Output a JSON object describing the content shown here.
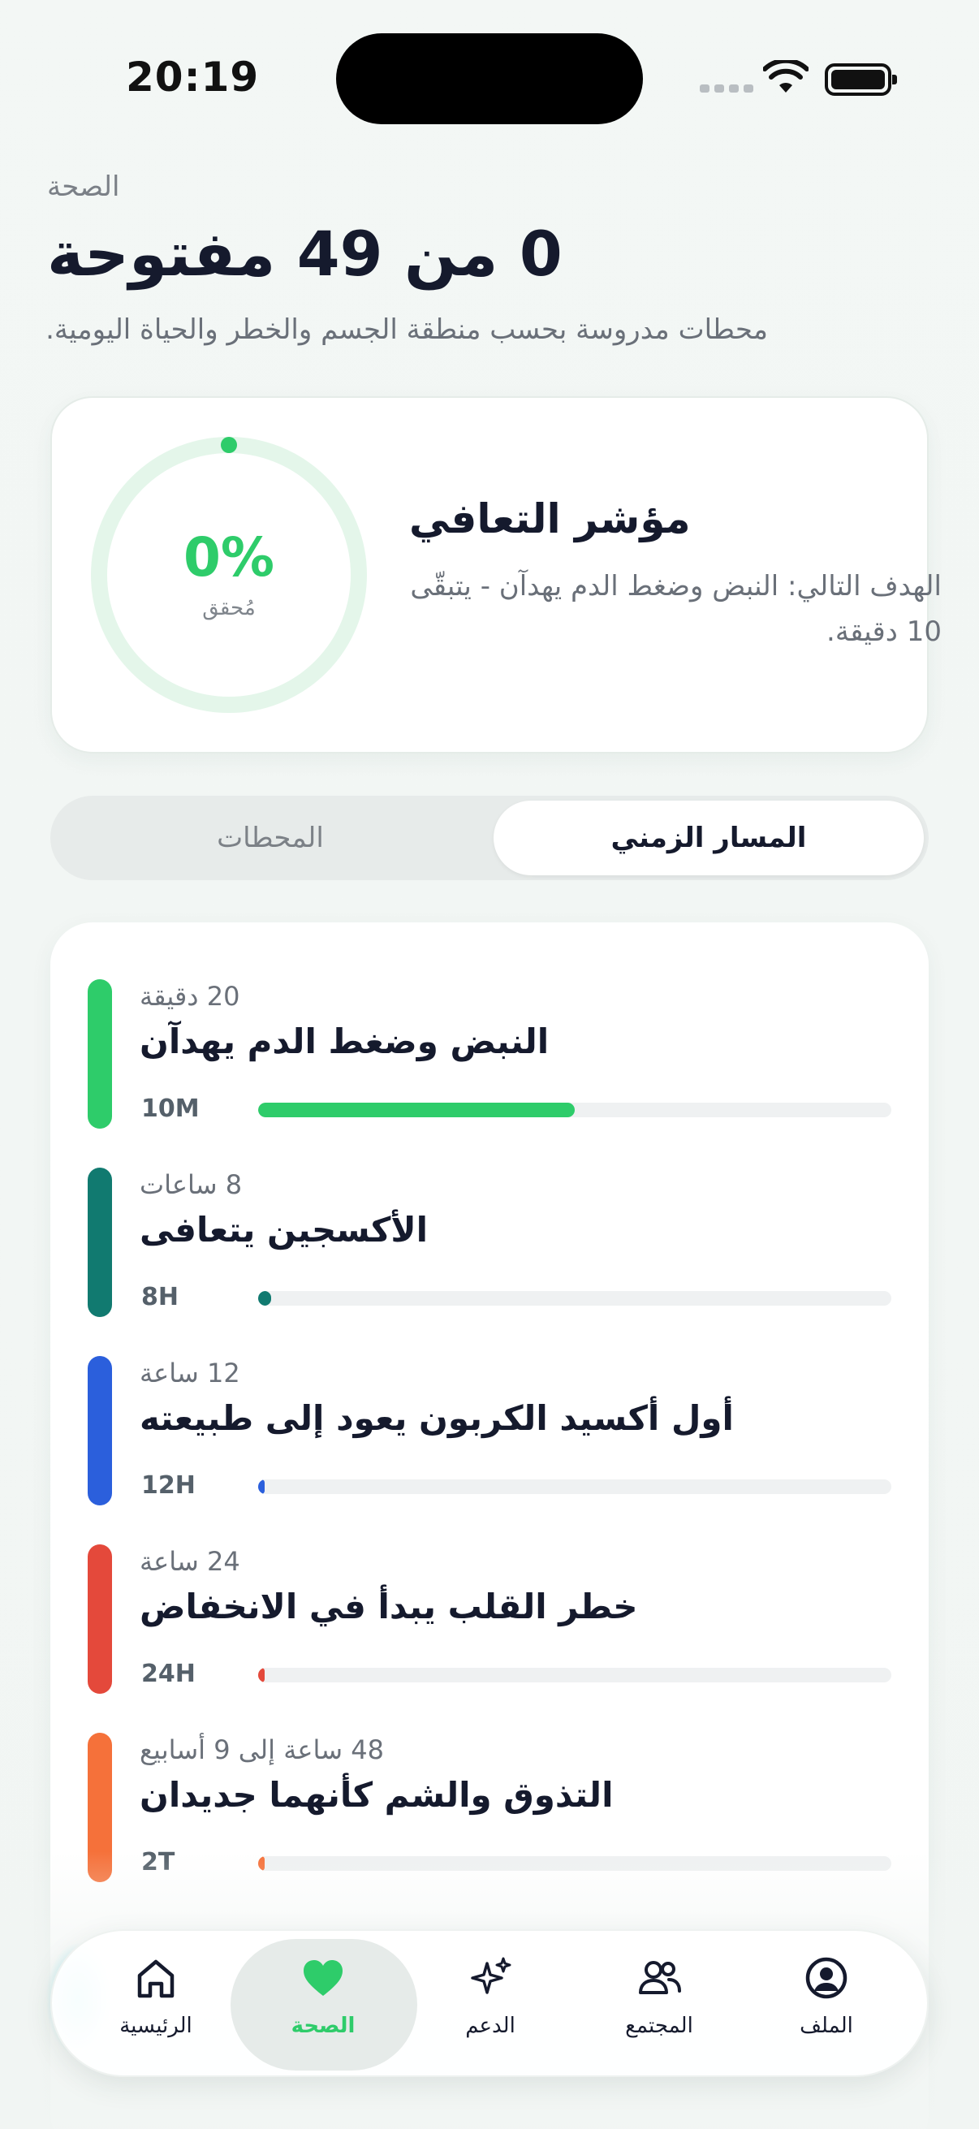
{
  "status_bar": {
    "time": "20:19"
  },
  "header": {
    "eyebrow": "الصحة",
    "title": "0 من 49 مفتوحة",
    "subtitle": "محطات مدروسة بحسب منطقة الجسم والخطر والحياة اليومية."
  },
  "recovery": {
    "title": "مؤشر التعافي",
    "description": "الهدف التالي: النبض وضغط الدم يهدآن - يتبقّى 10 دقيقة.",
    "percent_label": "0%",
    "percent_value": 0,
    "ring_caption": "مُحقق",
    "accent": "#2ecc6a"
  },
  "segmented": {
    "timeline_label": "المسار الزمني",
    "stations_label": "المحطات",
    "selected": "timeline"
  },
  "stages": [
    {
      "eyebrow": "20 دقيقة",
      "name": "النبض وضغط الدم يهدآن",
      "code": "10M",
      "progress": 0.5,
      "color": "#2ecc6a"
    },
    {
      "eyebrow": "8 ساعات",
      "name": "الأكسجين يتعافى",
      "code": "8H",
      "progress": 0.02,
      "color": "#117a70"
    },
    {
      "eyebrow": "12 ساعة",
      "name": "أول أكسيد الكربون يعود إلى طبيعته",
      "code": "12H",
      "progress": 0.01,
      "color": "#2b5fdc"
    },
    {
      "eyebrow": "24 ساعة",
      "name": "خطر القلب يبدأ في الانخفاض",
      "code": "24H",
      "progress": 0.005,
      "color": "#e4493b"
    },
    {
      "eyebrow": "48 ساعة إلى 9 أسابيع",
      "name": "التذوق والشم كأنهما جديدان",
      "code": "2T",
      "progress": 0.003,
      "color": "#f5713a"
    }
  ],
  "nav": {
    "items": [
      {
        "label": "الرئيسية",
        "icon": "home-icon"
      },
      {
        "label": "الصحة",
        "icon": "heart-icon",
        "active": true
      },
      {
        "label": "الدعم",
        "icon": "sparkles-icon"
      },
      {
        "label": "المجتمع",
        "icon": "people-icon"
      },
      {
        "label": "الملف",
        "icon": "profile-icon"
      }
    ]
  }
}
